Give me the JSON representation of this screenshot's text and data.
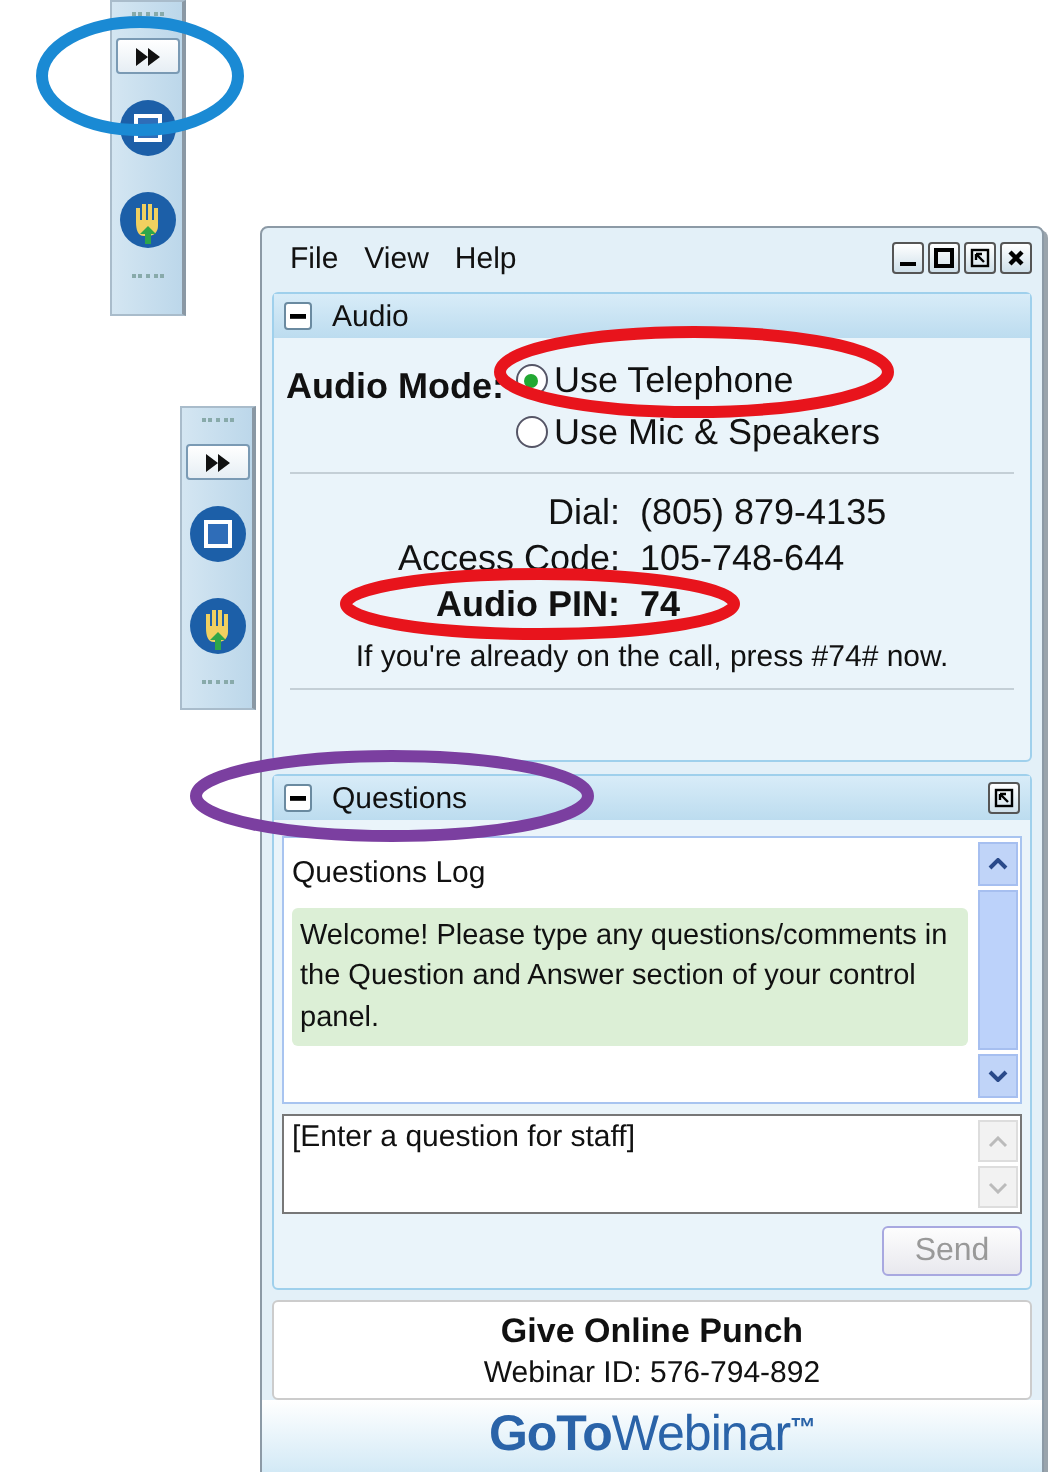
{
  "menu": [
    "File",
    "View",
    "Help"
  ],
  "audio": {
    "title": "Audio",
    "mode_label": "Audio Mode:",
    "options": [
      {
        "label": "Use Telephone",
        "selected": true
      },
      {
        "label": "Use Mic & Speakers",
        "selected": false
      }
    ],
    "dial_label": "Dial:",
    "dial": "(805) 879-4135",
    "code_label": "Access Code:",
    "code": "105-748-644",
    "pin_label": "Audio PIN:",
    "pin": "74",
    "note": "If you're already on the call, press #74# now."
  },
  "questions": {
    "title": "Questions",
    "log_title": "Questions Log",
    "welcome": "Welcome! Please type any questions/comments in the Question and Answer section of your control panel.",
    "placeholder": "[Enter a question for staff]",
    "send": "Send",
    "send_disabled": true
  },
  "footer": {
    "title": "Give Online Punch",
    "webinar_id": "Webinar ID: 576-794-892",
    "logo_bold": "GoTo",
    "logo_light": "Webinar",
    "logo_mark": "™"
  },
  "annotations": [
    {
      "color": "#1a8ad4"
    },
    {
      "color": "#e8141c"
    },
    {
      "color": "#e8141c"
    },
    {
      "color": "#7b3fa0"
    }
  ]
}
